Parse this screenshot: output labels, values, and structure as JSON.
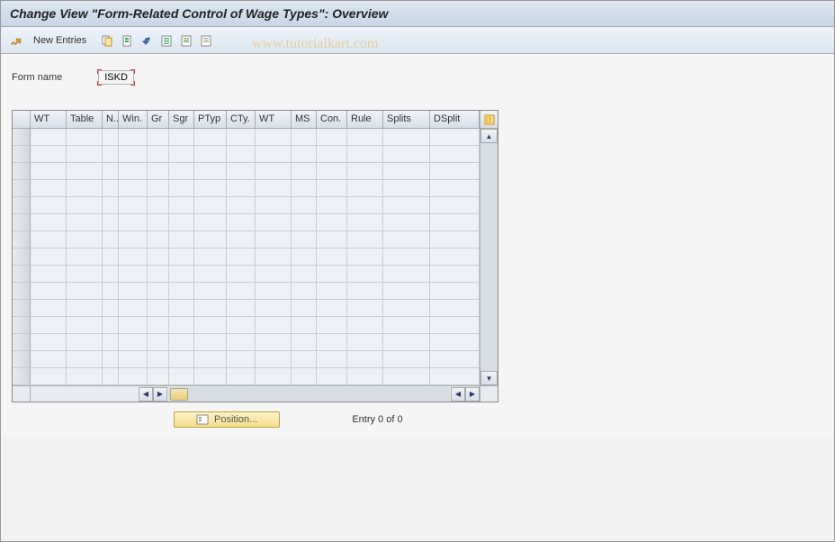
{
  "title": "Change View \"Form-Related Control of Wage Types\": Overview",
  "toolbar": {
    "new_entries": "New Entries"
  },
  "watermark": "www.tutorialkart.com",
  "form": {
    "name_label": "Form name",
    "name_value": "ISKD"
  },
  "table": {
    "columns": [
      {
        "key": "WT",
        "label": "WT",
        "width": 40
      },
      {
        "key": "Table",
        "label": "Table",
        "width": 40
      },
      {
        "key": "N",
        "label": "N..",
        "width": 18
      },
      {
        "key": "Win",
        "label": "Win.",
        "width": 32
      },
      {
        "key": "Gr",
        "label": "Gr",
        "width": 24
      },
      {
        "key": "Sgr",
        "label": "Sgr",
        "width": 28
      },
      {
        "key": "PTyp",
        "label": "PTyp",
        "width": 36
      },
      {
        "key": "CTy",
        "label": "CTy.",
        "width": 32
      },
      {
        "key": "WT2",
        "label": "WT",
        "width": 40
      },
      {
        "key": "MS",
        "label": "MS",
        "width": 28
      },
      {
        "key": "Con",
        "label": "Con.",
        "width": 34
      },
      {
        "key": "Rule",
        "label": "Rule",
        "width": 40
      },
      {
        "key": "Splits",
        "label": "Splits",
        "width": 52
      },
      {
        "key": "DSplit",
        "label": "DSplit",
        "width": 55
      }
    ],
    "rows": 15
  },
  "footer": {
    "position_label": "Position...",
    "entry_text": "Entry 0 of 0"
  }
}
